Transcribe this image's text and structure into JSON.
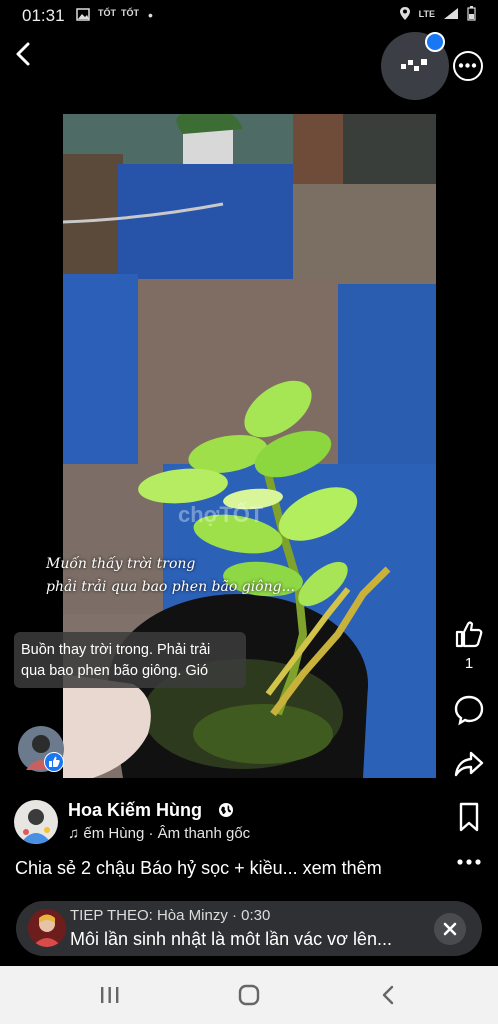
{
  "status_bar": {
    "time": "01:31",
    "carrier_labels": [
      "TỐT",
      "TỐT"
    ],
    "network": "LTE"
  },
  "icons": {
    "back": "chevron-left-icon",
    "reel_badge": "reels-badge-icon",
    "more_top": "more-horizontal-icon",
    "like": "thumbs-up-icon",
    "comment": "comment-icon",
    "share": "share-icon",
    "save": "bookmark-icon",
    "more": "more-horizontal-icon"
  },
  "video": {
    "overlay_line1": "Muốn thấy trời trong",
    "overlay_line2": "phải trải qua bao phen bão giông...",
    "watermark": "chợTỐT"
  },
  "subtitle": {
    "line1": "Buồn thay trời trong. Phải trải",
    "line2": "qua bao phen bão giông. Gió"
  },
  "actions": {
    "like_count": "1"
  },
  "post": {
    "author": "Hoa Kiếm Hùng",
    "audio": "ếm Hùng · Âm thanh gốc",
    "description": "Chia sẻ 2 chậu Báo hỷ sọc + kiều... xem thêm"
  },
  "up_next": {
    "label": "TIEP THEO: Hòa Minzy · 0:30",
    "title": "Môi lần sinh nhật là môt lần vác vơ lên..."
  },
  "colors": {
    "accent": "#1877f2",
    "background": "#000000",
    "leaf_green": "#9fe04a"
  }
}
